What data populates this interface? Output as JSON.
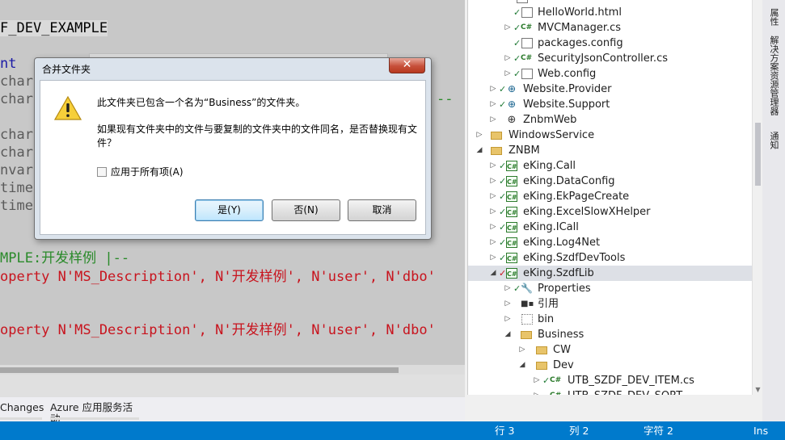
{
  "editor": {
    "lines": [
      {
        "text": "F_DEV_EXAMPLE",
        "color": "#1e1e1e"
      },
      {
        "text": "nt  p",
        "color": "#1a1aa6"
      },
      {
        "text": "char",
        "color": "#5a5a5a"
      },
      {
        "text": "char",
        "color": "#5a5a5a"
      },
      {
        "text": "--",
        "color": "#2a8a2a"
      },
      {
        "text": "char",
        "color": "#5a5a5a"
      },
      {
        "text": "char",
        "color": "#5a5a5a"
      },
      {
        "text": "nvare",
        "color": "#5a5a5a"
      },
      {
        "text": "time",
        "color": "#5a5a5a"
      },
      {
        "text": "time",
        "color": "#5a5a5a"
      },
      {
        "text": "MPLE:开发样例 |--",
        "color": "#2a8a2a"
      },
      {
        "text": "operty N'MS_Description', N'开发样例', N'user', N'dbo'",
        "color": "#c8141e"
      },
      {
        "text": "operty N'MS_Description', N'开发样例', N'user', N'dbo'",
        "color": "#c8141e"
      }
    ]
  },
  "tool_tabs": [
    {
      "label": "Changes"
    },
    {
      "label": "Azure 应用服务活动"
    }
  ],
  "explorer": {
    "rows": [
      {
        "label": "HelloWorld.html",
        "icon": "file-icon",
        "arrow": "",
        "check": "✓"
      },
      {
        "label": "MVCManager.cs",
        "icon": "cs-file-icon",
        "arrow": "▷",
        "check": "✓"
      },
      {
        "label": "packages.config",
        "icon": "file-icon",
        "arrow": "",
        "check": "✓"
      },
      {
        "label": "SecurityJsonController.cs",
        "icon": "cs-file-icon",
        "arrow": "▷",
        "check": "✓"
      },
      {
        "label": "Web.config",
        "icon": "file-icon",
        "arrow": "▷",
        "check": "✓"
      },
      {
        "label": "Website.Provider",
        "icon": "web-project-icon",
        "arrow": "▷",
        "check": "✓"
      },
      {
        "label": "Website.Support",
        "icon": "web-project-icon",
        "arrow": "▷",
        "check": "✓"
      },
      {
        "label": "ZnbmWeb",
        "icon": "globe-icon",
        "arrow": "▷",
        "check": ""
      },
      {
        "label": "WindowsService",
        "icon": "folder-icon",
        "arrow": "▷",
        "check": ""
      },
      {
        "label": "ZNBM",
        "icon": "folder-icon",
        "arrow": "◢",
        "check": ""
      },
      {
        "label": "eKing.Call",
        "icon": "cs-project-icon",
        "arrow": "▷",
        "check": "✓"
      },
      {
        "label": "eKing.DataConfig",
        "icon": "cs-project-icon",
        "arrow": "▷",
        "check": "✓"
      },
      {
        "label": "eKing.EkPageCreate",
        "icon": "cs-project-icon",
        "arrow": "▷",
        "check": "✓"
      },
      {
        "label": "eKing.ExcelSlowXHelper",
        "icon": "cs-project-icon",
        "arrow": "▷",
        "check": "✓"
      },
      {
        "label": "eKing.ICall",
        "icon": "cs-project-icon",
        "arrow": "▷",
        "check": "✓"
      },
      {
        "label": "eKing.Log4Net",
        "icon": "cs-project-icon",
        "arrow": "▷",
        "check": "✓"
      },
      {
        "label": "eKing.SzdfDevTools",
        "icon": "cs-project-icon",
        "arrow": "▷",
        "check": "✓"
      },
      {
        "label": "eKing.SzdfLib",
        "icon": "cs-project-icon",
        "arrow": "◢",
        "check": "✓"
      },
      {
        "label": "Properties",
        "icon": "wrench-icon",
        "arrow": "▷",
        "check": "✓"
      },
      {
        "label": "引用",
        "icon": "references-icon",
        "arrow": "▷",
        "check": ""
      },
      {
        "label": "bin",
        "icon": "bin-folder-icon",
        "arrow": "▷",
        "check": ""
      },
      {
        "label": "Business",
        "icon": "folder-icon",
        "arrow": "◢",
        "check": ""
      },
      {
        "label": "CW",
        "icon": "folder-icon",
        "arrow": "▷",
        "check": ""
      },
      {
        "label": "Dev",
        "icon": "folder-icon",
        "arrow": "◢",
        "check": ""
      },
      {
        "label": "UTB_SZDF_DEV_ITEM.cs",
        "icon": "cs-file-icon",
        "arrow": "▷",
        "check": "✓"
      },
      {
        "label": "UTB_SZDF_DEV_SORT",
        "icon": "cs-file-icon",
        "arrow": "▷",
        "check": ""
      }
    ]
  },
  "side_rail": [
    {
      "label": "属性"
    },
    {
      "label": "解决方案资源管理器"
    },
    {
      "label": "通知"
    }
  ],
  "statusbar": {
    "row": "行 3",
    "col": "列 2",
    "char": "字符 2",
    "mode": "Ins"
  },
  "dialog": {
    "title": "合并文件夹",
    "close_glyph": "✕",
    "message1": "此文件夹已包含一个名为“Business”的文件夹。",
    "message2": "如果现有文件夹中的文件与要复制的文件夹中的文件同名，是否替换现有文件？",
    "apply_all_label": "应用于所有项(A)",
    "yes_label": "是(Y)",
    "no_label": "否(N)",
    "cancel_label": "取消"
  },
  "colors": {
    "status_blue": "#007acc",
    "selection": "#dde0e6",
    "string_red": "#c8141e",
    "comment_green": "#2a8a2a"
  }
}
